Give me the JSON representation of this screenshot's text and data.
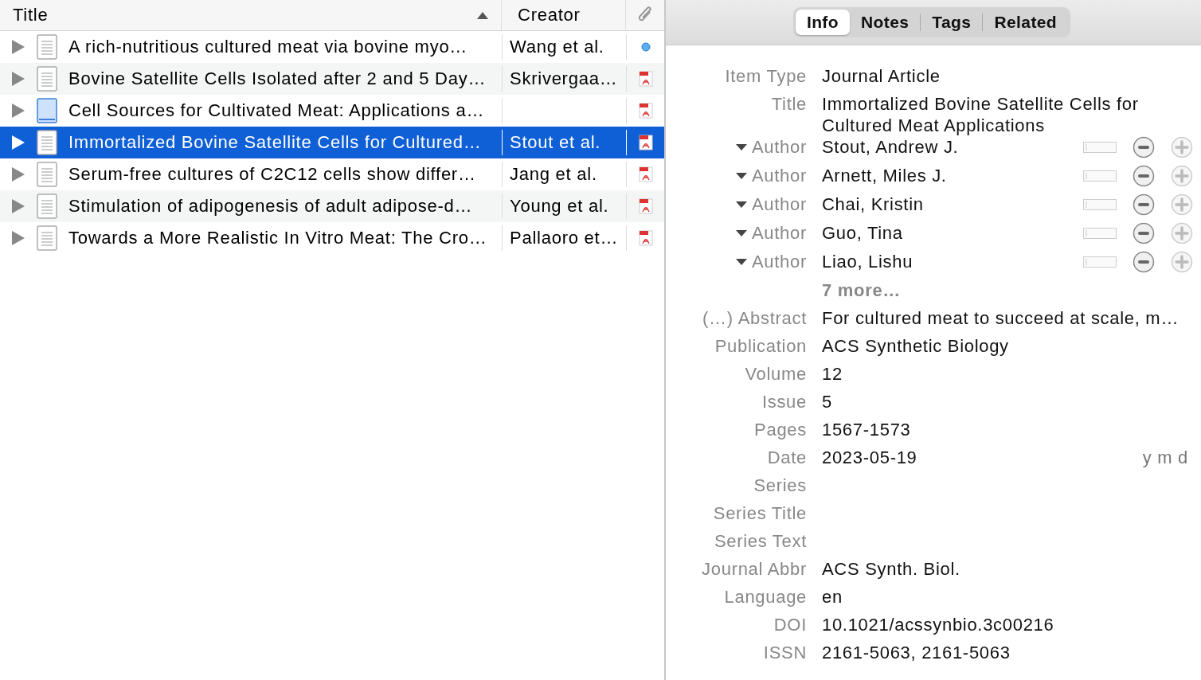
{
  "items_pane": {
    "columns": [
      {
        "label": "Title",
        "sorted": true
      },
      {
        "label": "Creator",
        "sorted": false
      }
    ],
    "rows": [
      {
        "kind": "document",
        "title": "A rich-nutritious cultured meat via bovine myo…",
        "creator": "Wang et al.",
        "attachment": {
          "kind": "dot"
        },
        "selected": false
      },
      {
        "kind": "document",
        "title": "Bovine Satellite Cells Isolated after 2 and 5 Day…",
        "creator": "Skrivergaa…",
        "attachment": {
          "kind": "pdf"
        },
        "selected": false
      },
      {
        "kind": "web-page",
        "title": "Cell Sources for Cultivated Meat: Applications a…",
        "attachment": {
          "kind": "pdf"
        },
        "selected": false
      },
      {
        "kind": "document",
        "title": "Immortalized Bovine Satellite Cells for Cultured…",
        "creator": "Stout et al.",
        "attachment": {
          "kind": "pdf"
        },
        "selected": true
      },
      {
        "kind": "document",
        "title": "Serum-free cultures of C2C12 cells show differ…",
        "creator": "Jang et al.",
        "attachment": {
          "kind": "pdf"
        },
        "selected": false
      },
      {
        "kind": "document",
        "title": "Stimulation of adipogenesis of adult adipose-d…",
        "creator": "Young et al.",
        "attachment": {
          "kind": "pdf"
        },
        "selected": false
      },
      {
        "kind": "document",
        "title": "Towards a More Realistic In Vitro Meat: The Cro…",
        "creator": "Pallaoro et…",
        "attachment": {
          "kind": "pdf"
        },
        "selected": false
      }
    ]
  },
  "item_pane": {
    "tabs": [
      {
        "label": "Info",
        "selected": true
      },
      {
        "label": "Notes",
        "selected": false
      },
      {
        "label": "Tags",
        "selected": false
      },
      {
        "label": "Related",
        "selected": false
      }
    ],
    "fields": [
      {
        "kind": "text",
        "label": "Item Type",
        "value": "Journal Article"
      },
      {
        "kind": "text",
        "label": "Title",
        "value": "Immortalized Bovine Satellite Cells for Cultured Meat Applications"
      },
      {
        "kind": "author",
        "label": "Author",
        "value": "Stout, Andrew J."
      },
      {
        "kind": "author",
        "label": "Author",
        "value": "Arnett, Miles J."
      },
      {
        "kind": "author",
        "label": "Author",
        "value": "Chai, Kristin"
      },
      {
        "kind": "author",
        "label": "Author",
        "value": "Guo, Tina"
      },
      {
        "kind": "author",
        "label": "Author",
        "value": "Liao, Lishu"
      },
      {
        "kind": "more",
        "value": "7 more…"
      },
      {
        "kind": "abstract",
        "label": "Abstract",
        "toggle": "(…)",
        "value": "For cultured meat to succeed at scale, m…"
      },
      {
        "kind": "text",
        "label": "Publication",
        "value": "ACS Synthetic Biology"
      },
      {
        "kind": "text",
        "label": "Volume",
        "value": "12"
      },
      {
        "kind": "text",
        "label": "Issue",
        "value": "5"
      },
      {
        "kind": "text",
        "label": "Pages",
        "value": "1567-1573"
      },
      {
        "kind": "date",
        "label": "Date",
        "value": "2023-05-19",
        "format": "y m d"
      },
      {
        "kind": "text",
        "label": "Series"
      },
      {
        "kind": "text",
        "label": "Series Title"
      },
      {
        "kind": "text",
        "label": "Series Text"
      },
      {
        "kind": "text",
        "label": "Journal Abbr",
        "value": "ACS Synth. Biol."
      },
      {
        "kind": "text",
        "label": "Language",
        "value": "en"
      },
      {
        "kind": "text",
        "label": "DOI",
        "value": "10.1021/acssynbio.3c00216"
      },
      {
        "kind": "text",
        "label": "ISSN",
        "value": "2161-5063, 2161-5063"
      }
    ]
  }
}
